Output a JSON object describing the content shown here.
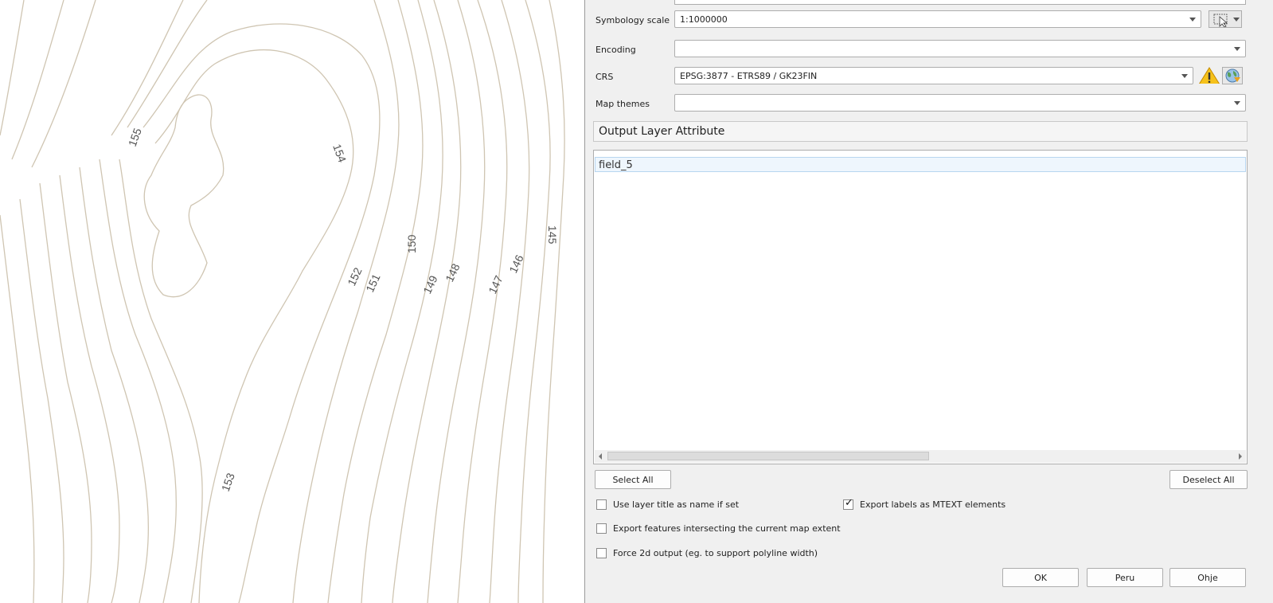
{
  "map": {
    "contour_labels": [
      "155",
      "154",
      "150",
      "145",
      "152",
      "151",
      "149",
      "148",
      "147",
      "146",
      "153"
    ]
  },
  "dialog": {
    "symbology_scale": {
      "label": "Symbology scale",
      "value": "1:1000000"
    },
    "encoding": {
      "label": "Encoding",
      "value": ""
    },
    "crs": {
      "label": "CRS",
      "value": "EPSG:3877 - ETRS89 / GK23FIN"
    },
    "map_themes": {
      "label": "Map themes",
      "value": ""
    },
    "output_layer_attribute": {
      "header": "Output Layer Attribute",
      "items": [
        "field_5"
      ]
    },
    "buttons": {
      "select_all": "Select All",
      "deselect_all": "Deselect All",
      "ok": "OK",
      "cancel": "Peru",
      "help": "Ohje"
    },
    "checkboxes": {
      "use_layer_title": {
        "label": "Use layer title as name if set",
        "checked": false
      },
      "export_labels": {
        "label": "Export labels as MTEXT elements",
        "checked": true
      },
      "export_intersecting": {
        "label": "Export features intersecting the current map extent",
        "checked": false
      },
      "force_2d": {
        "label": "Force 2d output (eg. to support polyline width)",
        "checked": false
      }
    },
    "icons": {
      "pick_scale": "cursor-select-icon",
      "crs_warning": "warning-icon",
      "crs_select": "globe-icon"
    }
  }
}
